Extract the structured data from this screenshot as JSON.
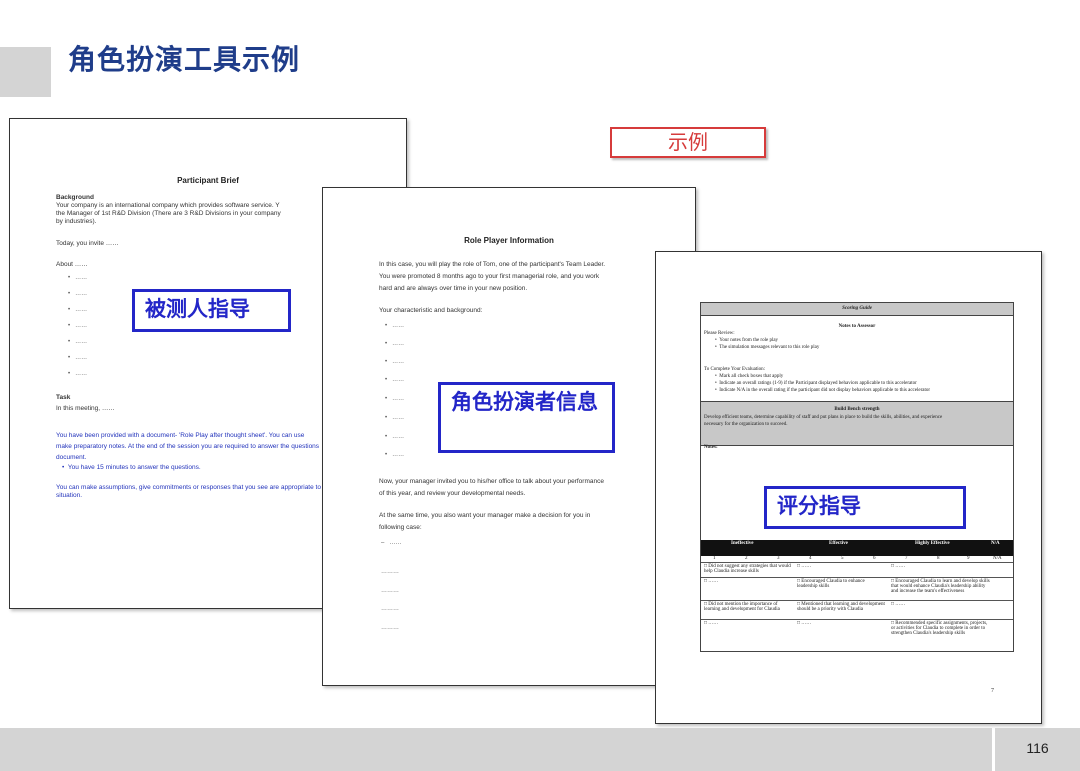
{
  "slide": {
    "title": "角色扮演工具示例",
    "example_badge": "示例",
    "page_number": "116"
  },
  "labels": {
    "participant": "被测人指导",
    "role_player": "角色扮演者信息",
    "scoring": "评分指导"
  },
  "doc1": {
    "title": "Participant Brief",
    "background_heading": "Background",
    "background_line1": "Your company is an international company which provides software service. Y",
    "background_line2": "the Manager of 1st R&D Division (There are 3 R&D Divisions in your company",
    "background_line3": "by industries).",
    "today": "Today, you invite ……",
    "about": "About ……",
    "bullet_text": "……",
    "task_heading": "Task",
    "task_text": "In this meeting, ……",
    "provided_line1": "You have been provided with a document- 'Role Play after thought sheet'. You can use",
    "provided_line2": "make preparatory notes. At the end of the session you are required to answer the questions",
    "provided_line3": "document.",
    "minutes": "You have 15 minutes to answer the questions.",
    "assume_line1": "You can make assumptions, give commitments or responses that you see are appropriate to",
    "assume_line2": "situation."
  },
  "doc2": {
    "title": "Role Player Information",
    "intro_line1": "In this case, you will play the role of Tom, one of the participant's Team Leader.",
    "intro_line2": "You were promoted 8 months ago to your first managerial role, and you work",
    "intro_line3": "hard and are always over time in your new position.",
    "char_heading": "Your characteristic and background:",
    "bullet_text": "……",
    "now_line1": "Now, your manager invited you to his/her office to talk about your performance",
    "now_line2": "of this year, and review your developmental needs.",
    "same_line1": "At the same time, you also want your manager make a decision for you in",
    "same_line2": "following case:",
    "dash_text": "……",
    "dots_text": "………"
  },
  "doc3": {
    "sheet_title": "Scoring Guide",
    "notes_heading": "Notes to Assessor",
    "please_review": "Please Review:",
    "review1": "Your notes from the role play",
    "review2": "The simulation messages relevant to this role play",
    "to_complete": "To Complete Your Evaluation:",
    "complete1": "Mark all check boxes that apply",
    "complete2": "Indicate an overall ratings (1-9) if the Participant displayed behaviors applicable to this accelerator",
    "complete3": "Indicate N/A in the overall rating if the participant did not display behaviors applicable to this accelerator",
    "band_title": "Build Bench strength",
    "band_line1": "Develop efficient teams, determine capability of staff and put plans in place to build the skills, abilities, and experience",
    "band_line2": "necessary for the organization to succeed.",
    "notes_label": "Notes:",
    "col1": "Ineffective",
    "col2": "Effective",
    "col3": "Highly Effective",
    "col4": "N/A",
    "scale1": "1",
    "scale2": "2",
    "scale3": "3",
    "scale4": "4",
    "scale5": "5",
    "scale6": "6",
    "scale7": "7",
    "scale8": "8",
    "scale9": "9",
    "scale_na": "N/A",
    "r1c1": "Did not suggest any strategies that would help Claudia increase skills",
    "r2c2": "Encouraged Claudia to enhance leadership skills",
    "r2c3": "Encouraged Claudia to learn and develop skills that would enhance Claudia's leadership ability and increase the team's effectiveness",
    "r3c1": "Did not mention the importance of learning and development for Claudia",
    "r3c2": "Mentioned that learning and development should be a priority with Claudia",
    "r4c3": "Recommended specific assignments, projects, or activities for Claudia to complete in order to strengthen Claudia's leadership skills",
    "cell_dots": "……",
    "page": "7"
  }
}
